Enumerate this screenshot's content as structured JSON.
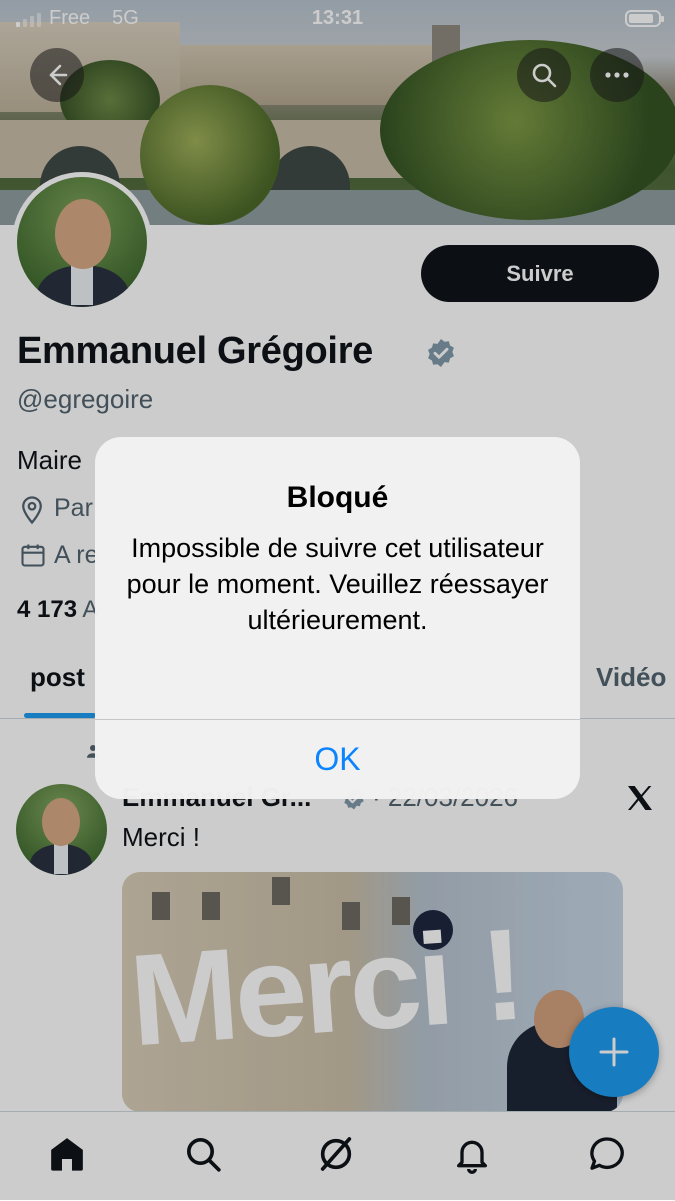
{
  "status_bar": {
    "carrier": "Free",
    "network": "5G",
    "time": "13:31"
  },
  "profile": {
    "follow_label": "Suivre",
    "name": "Emmanuel Grégoire",
    "handle": "@egregoire",
    "bio_visible": "Maire",
    "location_visible": "Par",
    "joined_visible": "A re",
    "following_count": "4 173",
    "following_visible": "A"
  },
  "tabs": {
    "posts_visible": "post",
    "videos_visible": "Vidéo"
  },
  "tweet": {
    "author_visible": "Emmanuel Gr...",
    "date_visible": "· 22/03/2026",
    "text": "Merci !",
    "image_text": "Merci !"
  },
  "alert": {
    "title": "Bloqué",
    "message": "Impossible de suivre cet utilisateur pour le moment. Veuillez réessayer ultérieurement.",
    "ok_label": "OK"
  },
  "icons": {
    "nav": [
      "home-icon",
      "search-icon",
      "grok-icon",
      "notifications-icon",
      "messages-icon"
    ],
    "header": [
      "back-arrow-icon",
      "search-icon",
      "more-icon"
    ]
  },
  "colors": {
    "accent": "#1d9bf0",
    "ios_button": "#0a84ff",
    "text": "#0f1419",
    "secondary": "#536471"
  }
}
